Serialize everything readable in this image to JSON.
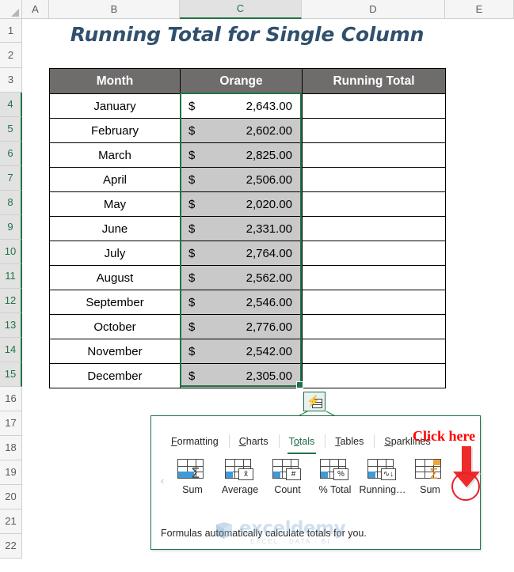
{
  "spreadsheet": {
    "column_headers": [
      "A",
      "B",
      "C",
      "D",
      "E"
    ],
    "selected_column": "C",
    "row_headers": [
      "1",
      "2",
      "3",
      "4",
      "5",
      "6",
      "7",
      "8",
      "9",
      "10",
      "11",
      "12",
      "13",
      "14",
      "15",
      "16",
      "17",
      "18",
      "19",
      "20",
      "21",
      "22"
    ],
    "selected_rows": [
      "4",
      "5",
      "6",
      "7",
      "8",
      "9",
      "10",
      "11",
      "12",
      "13",
      "14",
      "15"
    ],
    "title": "Running Total for Single Column",
    "title_color": "#31506E"
  },
  "table": {
    "headers": [
      "Month",
      "Orange",
      "Running Total"
    ],
    "header_bg": "#6F6C6C",
    "header_color": "#FFFFFF",
    "currency_symbol": "$",
    "rows": [
      {
        "month": "January",
        "orange": "2,643.00",
        "running_total": ""
      },
      {
        "month": "February",
        "orange": "2,602.00",
        "running_total": ""
      },
      {
        "month": "March",
        "orange": "2,825.00",
        "running_total": ""
      },
      {
        "month": "April",
        "orange": "2,506.00",
        "running_total": ""
      },
      {
        "month": "May",
        "orange": "2,020.00",
        "running_total": ""
      },
      {
        "month": "June",
        "orange": "2,331.00",
        "running_total": ""
      },
      {
        "month": "July",
        "orange": "2,764.00",
        "running_total": ""
      },
      {
        "month": "August",
        "orange": "2,562.00",
        "running_total": ""
      },
      {
        "month": "September",
        "orange": "2,546.00",
        "running_total": ""
      },
      {
        "month": "October",
        "orange": "2,776.00",
        "running_total": ""
      },
      {
        "month": "November",
        "orange": "2,542.00",
        "running_total": ""
      },
      {
        "month": "December",
        "orange": "2,305.00",
        "running_total": ""
      }
    ]
  },
  "quick_analysis": {
    "button_icon": "quick-analysis-icon",
    "accent_color": "#217346",
    "tabs": [
      {
        "accel": "F",
        "rest": "ormatting",
        "active": false
      },
      {
        "accel": "C",
        "rest": "harts",
        "active": false
      },
      {
        "accel": "T",
        "rest": "otals",
        "active": true,
        "mid": "o"
      },
      {
        "accel": "T",
        "rest": "ables",
        "active": false
      },
      {
        "accel": "S",
        "rest": "parklines",
        "active": false
      }
    ],
    "items": [
      {
        "label": "Sum",
        "icon": "sum-row-icon",
        "badge": "",
        "style": "row-blue-sigma"
      },
      {
        "label": "Average",
        "icon": "average-icon",
        "badge": "x̄",
        "style": "cell-blue-badge"
      },
      {
        "label": "Count",
        "icon": "count-icon",
        "badge": "#",
        "style": "cell-blue-badge"
      },
      {
        "label": "% Total",
        "icon": "percent-total-icon",
        "badge": "%",
        "style": "cell-blue-badge"
      },
      {
        "label": "Running…",
        "icon": "running-total-icon",
        "badge": "∿↓",
        "style": "cell-blue-badge"
      },
      {
        "label": "Sum",
        "icon": "sum-column-icon",
        "badge": "",
        "style": "col-orange-sigma"
      }
    ],
    "nav_left": "‹",
    "nav_right": "›",
    "footer": "Formulas automatically calculate totals for you."
  },
  "annotation": {
    "text": "Click here",
    "color": "#FF0000",
    "arrow": "down-arrow-icon",
    "highlight": "circle-highlight"
  },
  "watermark": {
    "brand": "exceldemy",
    "tagline": "EXCEL · DATA · BI"
  }
}
